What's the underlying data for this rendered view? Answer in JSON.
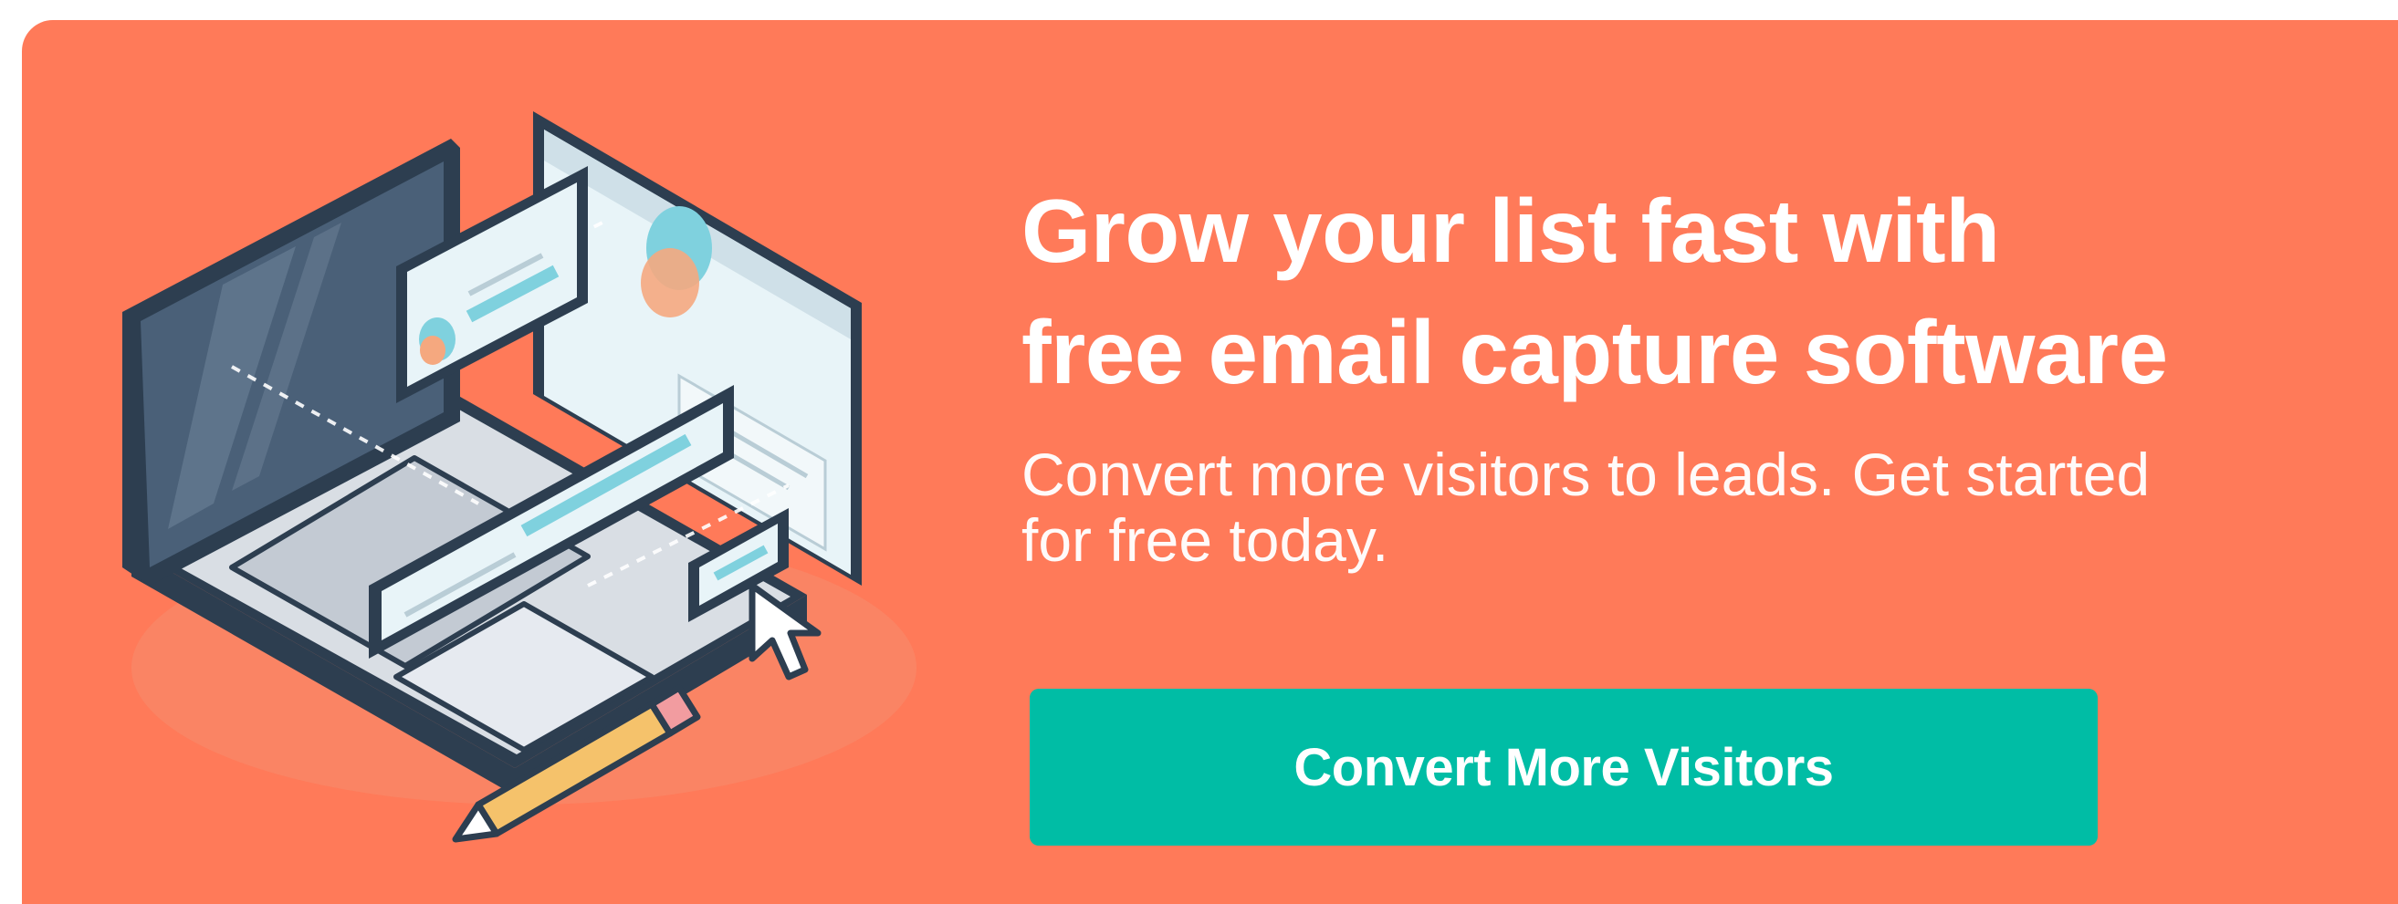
{
  "colors": {
    "banner_bg": "#FF7A59",
    "cta_bg": "#00BDA5",
    "outline": "#2D3E50",
    "screen": "#4A6078",
    "panel": "#E8F4F8",
    "accent_teal": "#7FD1DE",
    "pencil": "#F5C26B"
  },
  "headline": {
    "line1": "Grow your list fast with",
    "line2": "free email capture software"
  },
  "subline": {
    "line1": "Convert more visitors to leads. Get started",
    "line2": "for free today."
  },
  "cta": {
    "label": "Convert More Visitors"
  },
  "illustration": {
    "icons": [
      "laptop-icon",
      "browser-window-icon",
      "form-card-icon",
      "cursor-icon",
      "pencil-icon",
      "pie-chart-icon"
    ]
  }
}
